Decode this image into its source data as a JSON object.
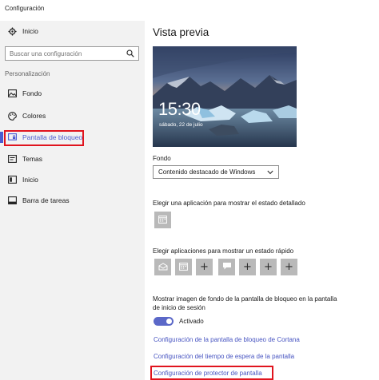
{
  "window": {
    "title": "Configuración"
  },
  "sidebar": {
    "home_label": "Inicio",
    "search_placeholder": "Buscar una configuración",
    "section_title": "Personalización",
    "items": [
      {
        "label": "Fondo",
        "icon": "image-icon"
      },
      {
        "label": "Colores",
        "icon": "palette-icon"
      },
      {
        "label": "Pantalla de bloqueo",
        "icon": "lock-screen-icon",
        "active": true
      },
      {
        "label": "Temas",
        "icon": "brush-icon"
      },
      {
        "label": "Inicio",
        "icon": "start-menu-icon"
      },
      {
        "label": "Barra de tareas",
        "icon": "taskbar-icon"
      }
    ]
  },
  "main": {
    "title": "Vista previa",
    "preview": {
      "time": "15:30",
      "date": "sábado, 22 de julio"
    },
    "background": {
      "label": "Fondo",
      "selected": "Contenido destacado de Windows"
    },
    "detailed_status": {
      "label": "Elegir una aplicación para mostrar el estado detallado",
      "app_icon": "calendar-icon"
    },
    "quick_status": {
      "label": "Elegir aplicaciones para mostrar un estado rápido",
      "slots": [
        {
          "icon": "mail-icon",
          "text": ""
        },
        {
          "icon": "calendar-icon",
          "text": ""
        },
        {
          "icon": "plus-icon",
          "text": "+"
        },
        {
          "icon": "chat-icon",
          "text": ""
        },
        {
          "icon": "plus-icon",
          "text": "+"
        },
        {
          "icon": "plus-icon",
          "text": "+"
        },
        {
          "icon": "plus-icon",
          "text": "+"
        }
      ]
    },
    "signin_background": {
      "label_line1": "Mostrar imagen de fondo de la pantalla de bloqueo en la pantalla",
      "label_line2": "de inicio de sesión",
      "state": "Activado",
      "on": true
    },
    "links": {
      "cortana": "Configuración de la pantalla de bloqueo de Cortana",
      "timeout": "Configuración del tiempo de espera de la pantalla",
      "screensaver": "Configuración de protector de pantalla"
    }
  },
  "colors": {
    "accent": "#4b5bd1",
    "highlight": "#e0141e",
    "link": "#4754c1"
  }
}
